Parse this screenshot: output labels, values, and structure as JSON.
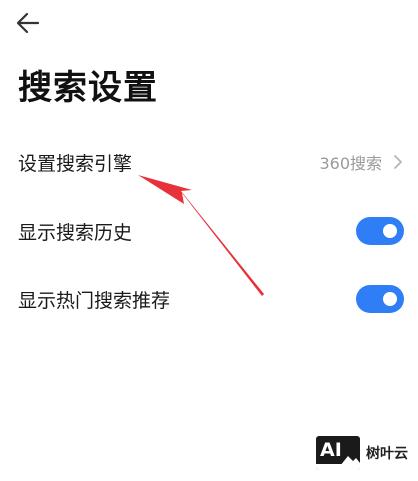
{
  "header": {
    "back_icon": "arrow-left-icon",
    "title": "搜索设置"
  },
  "settings": {
    "search_engine": {
      "label": "设置搜索引擎",
      "value": "360搜索",
      "icon": "chevron-right-icon"
    },
    "show_history": {
      "label": "显示搜索历史",
      "enabled": true
    },
    "show_hot": {
      "label": "显示热门搜索推荐",
      "enabled": true
    }
  },
  "colors": {
    "toggle_on": "#2f7ef5",
    "annotation_arrow": "#e8323a",
    "secondary_text": "#9a9a9a"
  },
  "watermark": {
    "logo_text": "AI",
    "text": "树叶云"
  }
}
